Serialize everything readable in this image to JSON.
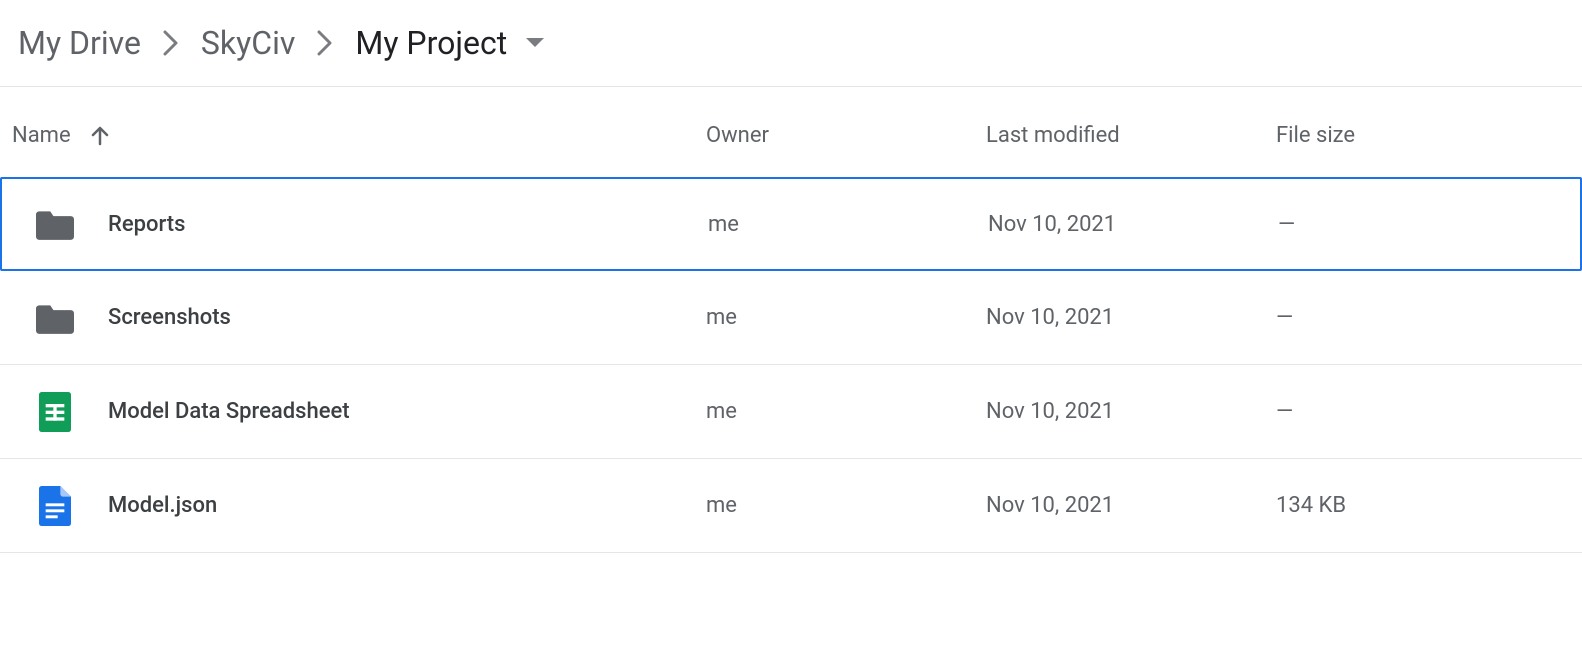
{
  "breadcrumb": {
    "items": [
      {
        "label": "My Drive"
      },
      {
        "label": "SkyCiv"
      },
      {
        "label": "My Project"
      }
    ]
  },
  "columns": {
    "name": "Name",
    "owner": "Owner",
    "modified": "Last modified",
    "size": "File size"
  },
  "files": [
    {
      "icon": "folder",
      "name": "Reports",
      "owner": "me",
      "modified": "Nov 10, 2021",
      "size": "—",
      "selected": true
    },
    {
      "icon": "folder",
      "name": "Screenshots",
      "owner": "me",
      "modified": "Nov 10, 2021",
      "size": "—",
      "selected": false
    },
    {
      "icon": "sheet",
      "name": "Model Data Spreadsheet",
      "owner": "me",
      "modified": "Nov 10, 2021",
      "size": "—",
      "selected": false
    },
    {
      "icon": "doc",
      "name": "Model.json",
      "owner": "me",
      "modified": "Nov 10, 2021",
      "size": "134 KB",
      "selected": false
    }
  ]
}
